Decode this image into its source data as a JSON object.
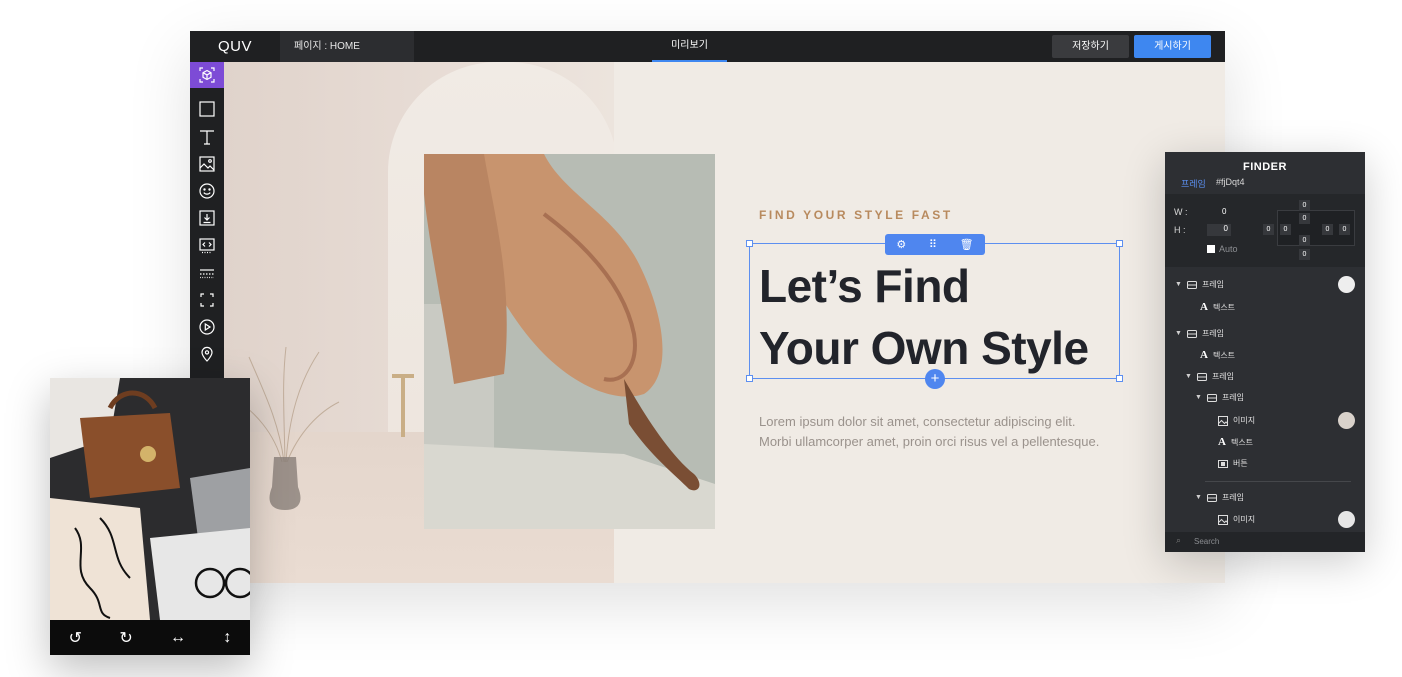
{
  "topbar": {
    "logo": "QUV",
    "page_selector": "페이지 : HOME",
    "preview_tab": "미리보기",
    "save_label": "저장하기",
    "publish_label": "게시하기"
  },
  "toolbar": {
    "tools": [
      "component-icon",
      "square-icon",
      "text-icon",
      "image-icon",
      "emoji-icon",
      "download-icon",
      "code-icon",
      "divider-icon",
      "fullscreen-icon",
      "play-icon",
      "location-icon"
    ]
  },
  "hero": {
    "kicker": "FIND YOUR STYLE FAST",
    "headline_line1": "Let’s Find",
    "headline_line2": "Your Own Style",
    "body_line1": "Lorem ipsum dolor sit amet, consectetur adipiscing elit.",
    "body_line2": "Morbi ullamcorper amet, proin orci risus vel a pellentesque.",
    "selection_toolbar": {
      "settings": "settings-icon",
      "drag": "drag-handle-icon",
      "delete": "trash-icon"
    },
    "add_label": "+"
  },
  "finder": {
    "title": "FINDER",
    "tab_label": "프레임",
    "element_id": "#fjDqt4",
    "w_label": "W :",
    "w_value": "0",
    "h_label": "H :",
    "h_value": "0",
    "auto_label": "Auto",
    "spacing": {
      "margin_top": "0",
      "padding_top": "0",
      "margin_left": "0",
      "padding_left": "0",
      "padding_right": "0",
      "margin_right": "0",
      "padding_bottom": "0",
      "margin_bottom": "0"
    },
    "tree": [
      {
        "label": "프레임",
        "type": "frame"
      },
      {
        "label": "텍스트",
        "type": "text"
      },
      {
        "label": "프레임",
        "type": "frame"
      },
      {
        "label": "텍스트",
        "type": "text"
      },
      {
        "label": "프레임",
        "type": "frame"
      },
      {
        "label": "프레임",
        "type": "frame"
      },
      {
        "label": "이미지",
        "type": "image"
      },
      {
        "label": "텍스트",
        "type": "text"
      },
      {
        "label": "버튼",
        "type": "button"
      },
      {
        "label": "프레임",
        "type": "frame"
      },
      {
        "label": "이미지",
        "type": "image"
      }
    ],
    "search_placeholder": "Search"
  },
  "image_editor": {
    "actions": [
      "rotate-left-icon",
      "rotate-right-icon",
      "flip-horizontal-icon",
      "flip-vertical-icon"
    ]
  },
  "colors": {
    "accent_blue": "#3e87f0",
    "active_tool": "#7d4bd6",
    "kicker": "#b88a5e",
    "headline": "#22242b"
  }
}
